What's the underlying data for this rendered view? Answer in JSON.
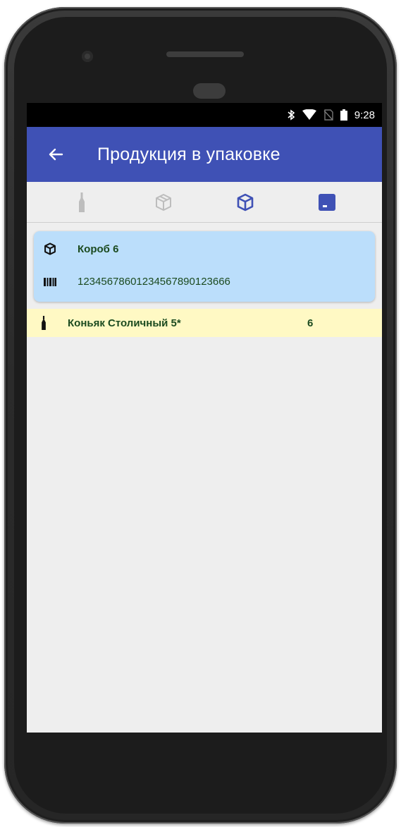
{
  "status_bar": {
    "time": "9:28",
    "icons": [
      "bluetooth-icon",
      "wifi-icon",
      "no-sim-icon",
      "battery-icon"
    ]
  },
  "app_bar": {
    "back_icon": "arrow-left-icon",
    "title": "Продукция в упаковке",
    "background": "#3f51b5"
  },
  "tabs": [
    {
      "icon": "bottle-icon",
      "active": false
    },
    {
      "icon": "box-outline-icon",
      "active": false
    },
    {
      "icon": "box-icon",
      "active": true
    },
    {
      "icon": "pallet-icon",
      "active": true
    }
  ],
  "box_card": {
    "icon": "box-icon",
    "name": "Короб 6",
    "barcode_icon": "barcode-icon",
    "barcode": "12345678601234567890123666",
    "background": "#bbdefb"
  },
  "products": [
    {
      "icon": "bottle-icon",
      "name": "Коньяк Столичный 5*",
      "quantity": "6",
      "background": "#fff9c4"
    }
  ],
  "colors": {
    "accent": "#3f51b5",
    "text_dark_green": "#1b4a1f",
    "screen_bg": "#eeeeee"
  }
}
